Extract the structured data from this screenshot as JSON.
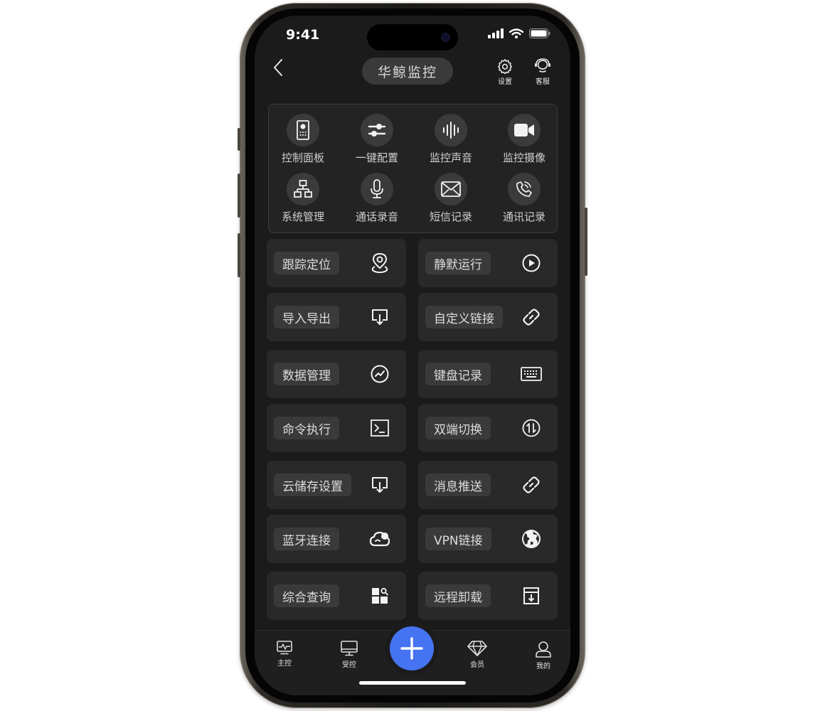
{
  "status_bar": {
    "time": "9:41"
  },
  "header": {
    "title": "华鲸监控",
    "settings_label": "设置",
    "support_label": "客服"
  },
  "features": [
    {
      "label": "控制面板",
      "icon": "remote-control-icon"
    },
    {
      "label": "一键配置",
      "icon": "sliders-icon"
    },
    {
      "label": "监控声音",
      "icon": "sound-wave-icon"
    },
    {
      "label": "监控摄像",
      "icon": "video-camera-icon"
    },
    {
      "label": "系统管理",
      "icon": "network-icon"
    },
    {
      "label": "通话录音",
      "icon": "microphone-icon"
    },
    {
      "label": "短信记录",
      "icon": "envelope-icon"
    },
    {
      "label": "通讯记录",
      "icon": "phone-call-icon"
    }
  ],
  "actions": [
    {
      "label": "跟踪定位",
      "icon": "location-pin-icon"
    },
    {
      "label": "静默运行",
      "icon": "play-circle-icon"
    },
    {
      "label": "导入导出",
      "icon": "download-tray-icon"
    },
    {
      "label": "自定义链接",
      "icon": "link-icon"
    },
    {
      "label": "数据管理",
      "icon": "trend-circle-icon"
    },
    {
      "label": "键盘记录",
      "icon": "keyboard-icon"
    },
    {
      "label": "命令执行",
      "icon": "terminal-icon"
    },
    {
      "label": "双端切换",
      "icon": "switch-arrows-icon"
    },
    {
      "label": "云储存设置",
      "icon": "download-tray-icon"
    },
    {
      "label": "消息推送",
      "icon": "link-icon"
    },
    {
      "label": "蓝牙连接",
      "icon": "cloud-icon"
    },
    {
      "label": "VPN链接",
      "icon": "globe-icon"
    },
    {
      "label": "综合查询",
      "icon": "grid-search-icon"
    },
    {
      "label": "远程卸载",
      "icon": "uninstall-box-icon"
    }
  ],
  "tabbar": {
    "items": [
      {
        "label": "主控",
        "icon": "monitor-pulse-icon"
      },
      {
        "label": "受控",
        "icon": "desktop-icon"
      },
      {
        "label": "会员",
        "icon": "diamond-icon"
      },
      {
        "label": "我的",
        "icon": "person-icon"
      }
    ]
  },
  "colors": {
    "accent": "#4573f2",
    "background": "#1b1b1c",
    "card": "#29292a",
    "chip": "#3a3a3b"
  }
}
